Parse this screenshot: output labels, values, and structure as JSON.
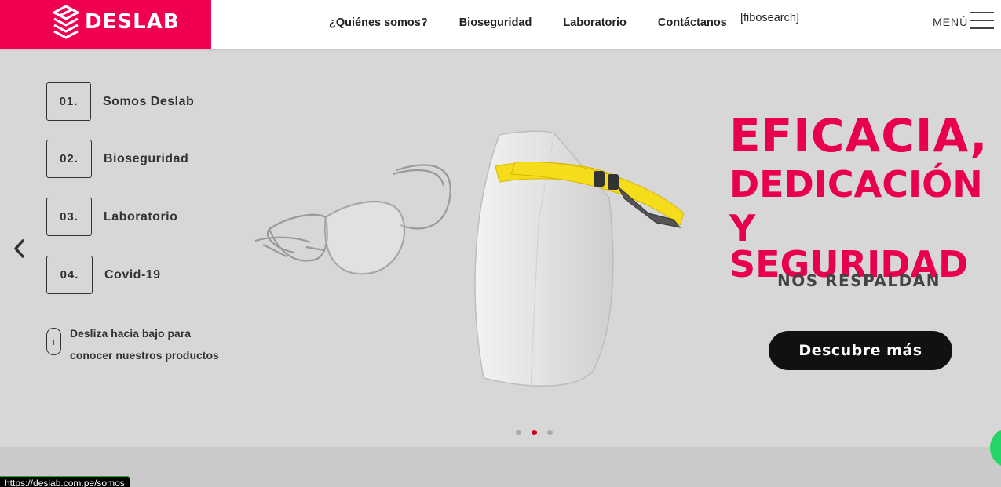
{
  "header": {
    "logo_text": "DESLAB",
    "nav": [
      "¿Quiénes somos?",
      "Bioseguridad",
      "Laboratorio",
      "Contáctanos"
    ],
    "search_placeholder_text": "[fibosearch]",
    "menu_label": "MENÚ"
  },
  "hero": {
    "side_menu": [
      {
        "num": "01.",
        "label": "Somos Deslab"
      },
      {
        "num": "02.",
        "label": "Bioseguridad"
      },
      {
        "num": "03.",
        "label": "Laboratorio"
      },
      {
        "num": "04.",
        "label": "Covid-19"
      }
    ],
    "scroll_hint_line1": "Desliza hacia bajo para",
    "scroll_hint_line2": "conocer nuestros productos",
    "headline_1": "EFICACIA,",
    "headline_2": "DEDICACIÓN",
    "headline_3": "Y SEGURIDAD",
    "subheadline": "NOS RESPALDAN",
    "cta_label": "Descubre más",
    "slide_count": 3,
    "active_slide": 2
  },
  "status_bar_url": "https://deslab.com.pe/somos",
  "colors": {
    "brand": "#f0004f",
    "headline": "#e8004d",
    "hero_bg": "#d7d7d7",
    "cta_bg": "#111111",
    "active_dot": "#c8001a"
  },
  "icons": [
    "deslab-logo-icon",
    "hamburger-icon",
    "chevron-left-icon",
    "mouse-scroll-icon",
    "whatsapp-icon"
  ]
}
